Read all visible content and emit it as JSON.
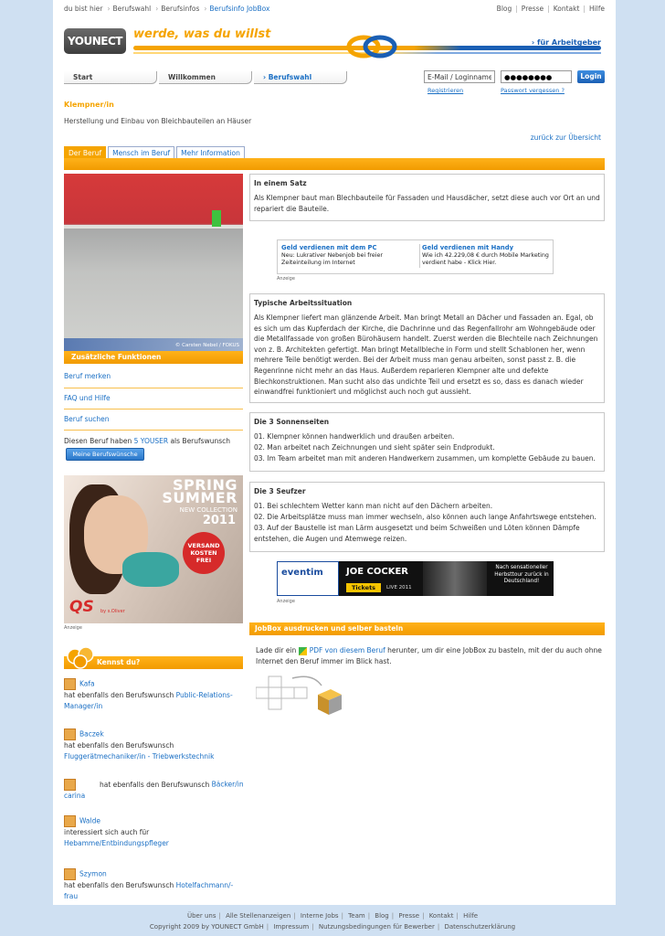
{
  "breadcrumb": {
    "items": [
      "du bist hier",
      "Berufswahl",
      "Berufsinfos",
      "Berufsinfo JobBox"
    ]
  },
  "topnav": [
    "Blog",
    "Presse",
    "Kontakt",
    "Hilfe"
  ],
  "header": {
    "logo": "YOUNECT",
    "slogan": "werde, was du willst",
    "employer_link": "› für Arbeitgeber"
  },
  "nav": {
    "tabs": [
      "Start",
      "Willkommen",
      "› Berufswahl"
    ]
  },
  "login": {
    "email_value": "E-Mail / Loginname",
    "password_value": "●●●●●●●●",
    "button": "Login",
    "register": "Registrieren",
    "forgot": "Passwort vergessen ?"
  },
  "job": {
    "title": "Klempner/in",
    "description": "Herstellung und Einbau von Bleichbauteilen an Häuser",
    "back_link": "zurück zur Übersicht"
  },
  "content_tabs": [
    "Der Beruf",
    "Mensch im Beruf",
    "Mehr Information"
  ],
  "photo": {
    "credit": "© Carsten Nebel / FOKUS"
  },
  "left": {
    "functions_header": "Zusätzliche Funktionen",
    "links": [
      "Beruf merken",
      "FAQ und Hilfe",
      "Beruf suchen"
    ],
    "wish_prefix": "Diesen Beruf haben",
    "wish_count": "5 YOUSER",
    "wish_suffix": "als Berufswunsch",
    "wish_button": "Meine Berufswünsche",
    "ad_label": "Anzeige",
    "ad": {
      "spring": "SPRING",
      "summer": "SUMMER",
      "new_collection": "NEW COLLECTION",
      "year": "2011",
      "badge": "VERSAND KOSTEN FREI",
      "brand": "QS",
      "brand_sub": "by s.Oliver"
    }
  },
  "kennst": {
    "title": "Kennst du?",
    "people": [
      {
        "name": "Kafa",
        "text": "hat ebenfalls den Berufswunsch",
        "job": "Public-Relations-Manager/in"
      },
      {
        "name": "Baczek",
        "text": "hat ebenfalls den Berufswunsch",
        "job": "Fluggerätmechaniker/in - Triebwerkstechnik"
      },
      {
        "name": "",
        "text": "hat ebenfalls den Berufswunsch",
        "job": "Bäcker/in",
        "job2": "carina"
      },
      {
        "name": "Walde",
        "text": "interessiert sich auch für",
        "job": "Hebamme/Entbindungspfleger"
      },
      {
        "name": "Szymon",
        "text": "hat ebenfalls den Berufswunsch",
        "job": "Hotelfachmann/-frau"
      }
    ]
  },
  "satz": {
    "heading": "In einem Satz",
    "text": "Als Klempner baut man Blechbauteile für Fassaden und Hausdächer, setzt diese auch vor Ort an und repariert die Bauteile."
  },
  "smallad": {
    "col1_title": "Geld verdienen mit dem PC",
    "col1_text": "Neu: Lukrativer Nebenjob bei freier Zeiteinteilung im Internet",
    "col2_title": "Geld verdienen mit Handy",
    "col2_text": "Wie ich 42.229,08 € durch Mobile Marketing verdient habe - Klick Hier.",
    "label": "Anzeige"
  },
  "arbeit": {
    "heading": "Typische Arbeitssituation",
    "text": "Als Klempner liefert man glänzende Arbeit. Man bringt Metall an Dächer und Fassaden an. Egal, ob es sich um das Kupferdach der Kirche, die Dachrinne und das Regenfallrohr am Wohngebäude oder die Metallfassade von großen Bürohäusern handelt. Zuerst werden die Blechteile nach Zeichnungen von z. B. Architekten gefertigt. Man bringt Metallbleche in Form und stellt Schablonen her, wenn mehrere Teile benötigt werden. Bei der Arbeit muss man genau arbeiten, sonst passt z. B. die Regenrinne nicht mehr an das Haus. Außerdem reparieren Klempner alte und defekte Blechkonstruktionen. Man sucht also das undichte Teil und ersetzt es so, dass es danach wieder einwandfrei funktioniert und möglichst auch noch gut aussieht."
  },
  "sonnen": {
    "heading": "Die 3 Sonnenseiten",
    "items": [
      "01.  Klempner können handwerklich und draußen arbeiten.",
      "02.  Man arbeitet nach Zeichnungen und sieht später sein Endprodukt.",
      "03.  Im Team arbeitet man mit anderen Handwerkern zusammen, um komplette Gebäude zu bauen."
    ]
  },
  "seufzer": {
    "heading": "Die 3 Seufzer",
    "items": [
      "01.  Bei schlechtem Wetter kann man nicht auf den Dächern arbeiten.",
      "02.  Die Arbeitsplätze muss man immer wechseln, also können auch lange Anfahrtswege entstehen.",
      "03.  Auf der Baustelle ist man Lärm ausgesetzt und beim Schweißen und Löten können Dämpfe entstehen, die Augen und Atemwege reizen."
    ]
  },
  "banner": {
    "brand": "eventim",
    "artist": "JOE COCKER",
    "tickets": "Tickets",
    "live": "LIVE 2011",
    "tour": "Nach sensationeller Herbsttour zurück in Deutschland!",
    "label": "Anzeige"
  },
  "jobbox": {
    "header": "JobBox ausdrucken und selber basteln",
    "text_before": "Lade dir ein",
    "link": "PDF von diesem Beruf",
    "text_after": "herunter, um dir eine JobBox zu basteln, mit der du auch ohne Internet den Beruf immer im Blick hast."
  },
  "footer": {
    "row1": [
      "Über uns",
      "Alle Stellenanzeigen",
      "Interne Jobs",
      "Team",
      "Blog",
      "Presse",
      "Kontakt",
      "Hilfe"
    ],
    "copyright": "Copyright 2009 by YOUNECT GmbH",
    "row2": [
      "Impressum",
      "Nutzungsbedingungen für Bewerber",
      "Datenschutzerklärung"
    ]
  }
}
